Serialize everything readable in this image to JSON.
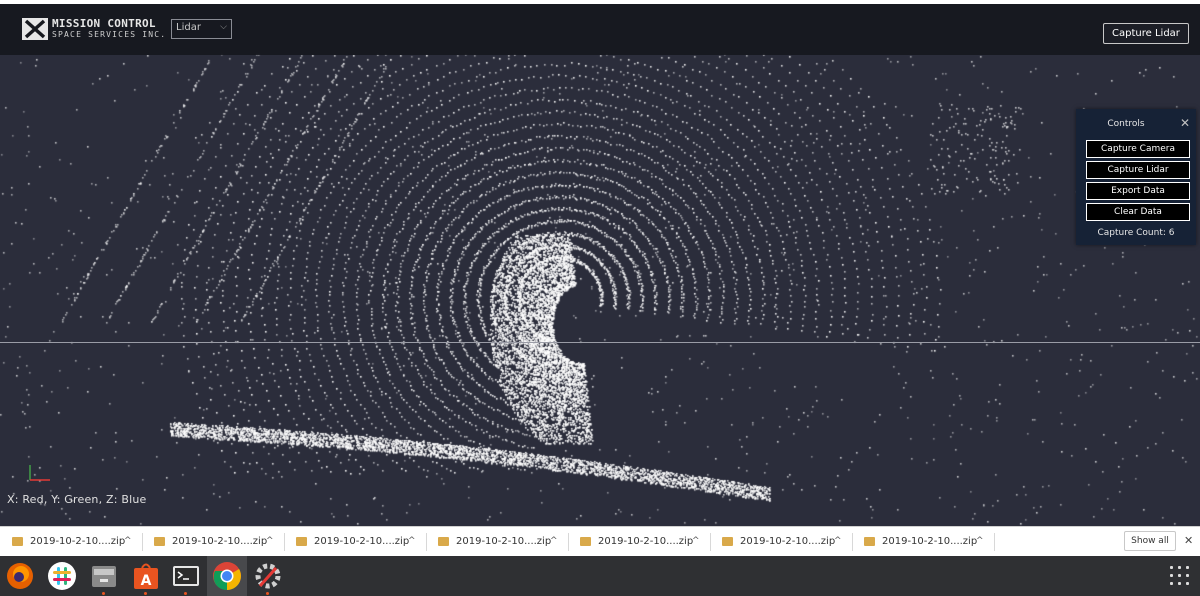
{
  "header": {
    "logo_title": "MISSION CONTROL",
    "logo_subtitle": "SPACE SERVICES INC.",
    "mode_select": "Lidar",
    "capture_button": "Capture Lidar"
  },
  "viewer": {
    "axis_legend": "X: Red, Y: Green, Z: Blue",
    "axis_colors": {
      "x": "#e53935",
      "y": "#43a047",
      "z": "#1e88e5"
    }
  },
  "controls": {
    "title": "Controls",
    "buttons": [
      "Capture Camera",
      "Capture Lidar",
      "Export Data",
      "Clear Data"
    ],
    "capture_count": "Capture Count: 6"
  },
  "downloads": {
    "items": [
      "2019-10-2-10....zip",
      "2019-10-2-10....zip",
      "2019-10-2-10....zip",
      "2019-10-2-10....zip",
      "2019-10-2-10....zip",
      "2019-10-2-10....zip",
      "2019-10-2-10....zip"
    ],
    "show_all": "Show all"
  },
  "taskbar": {
    "apps": [
      "firefox-icon",
      "slack-icon",
      "files-icon",
      "software-center-icon",
      "terminal-icon",
      "chrome-icon",
      "settings-tool-icon"
    ],
    "accent": "#e95420"
  }
}
